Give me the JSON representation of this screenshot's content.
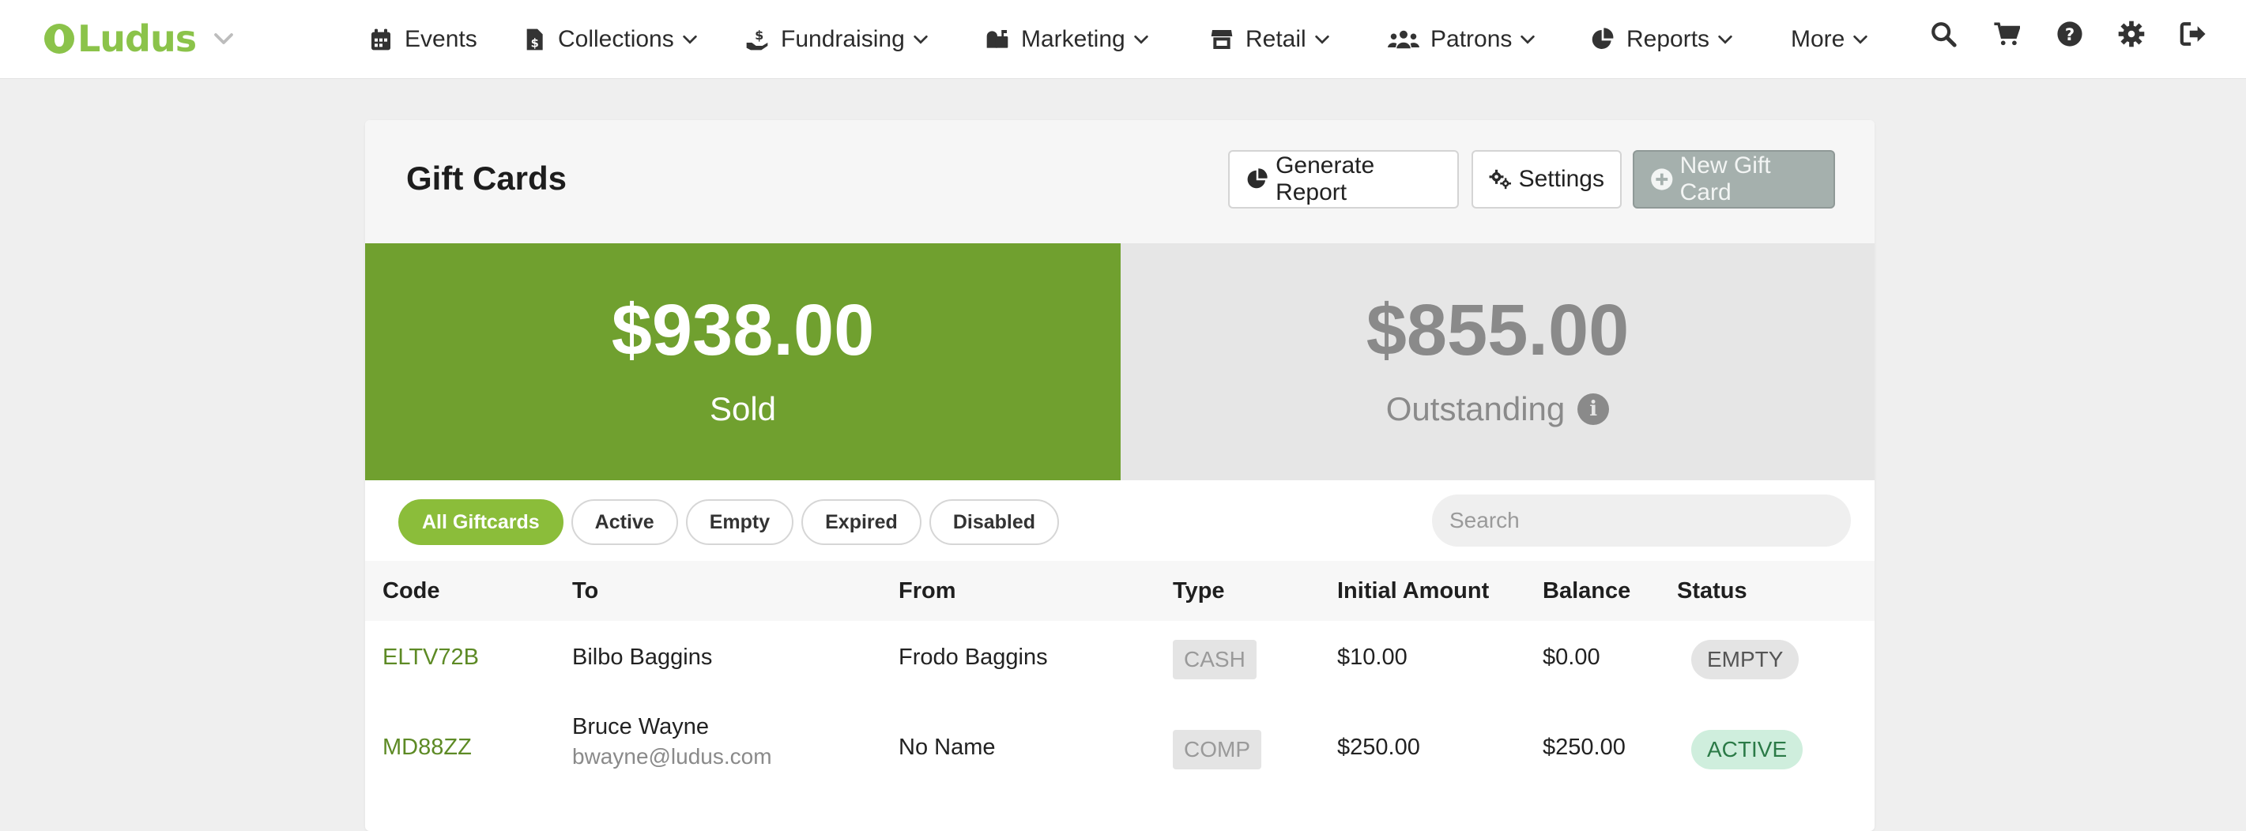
{
  "brand": {
    "name": "Ludus",
    "color": "#8bc34a"
  },
  "nav": {
    "events": "Events",
    "collections": "Collections",
    "fundraising": "Fundraising",
    "marketing": "Marketing",
    "retail": "Retail",
    "patrons": "Patrons",
    "reports": "Reports",
    "more": "More"
  },
  "page": {
    "title": "Gift Cards"
  },
  "actions": {
    "generate_report": "Generate Report",
    "settings": "Settings",
    "new_gift_card": "New Gift Card"
  },
  "stats": {
    "sold": {
      "amount": "$938.00",
      "label": "Sold",
      "color": "#70a02f"
    },
    "outstanding": {
      "amount": "$855.00",
      "label": "Outstanding"
    }
  },
  "filters": {
    "all": "All Giftcards",
    "active": "Active",
    "empty": "Empty",
    "expired": "Expired",
    "disabled": "Disabled",
    "selected": "All Giftcards"
  },
  "search": {
    "placeholder": "Search"
  },
  "table": {
    "headers": {
      "code": "Code",
      "to": "To",
      "from": "From",
      "type": "Type",
      "initial": "Initial Amount",
      "balance": "Balance",
      "status": "Status"
    },
    "rows": [
      {
        "code": "ELTV72B",
        "to": "Bilbo Baggins",
        "from": "Frodo Baggins",
        "type": "CASH",
        "initial": "$10.00",
        "balance": "$0.00",
        "status": "EMPTY"
      },
      {
        "code": "MD88ZZ",
        "to": "Bruce Wayne",
        "to_email": "bwayne@ludus.com",
        "from": "No Name",
        "type": "COMP",
        "initial": "$250.00",
        "balance": "$250.00",
        "status": "ACTIVE"
      }
    ]
  }
}
